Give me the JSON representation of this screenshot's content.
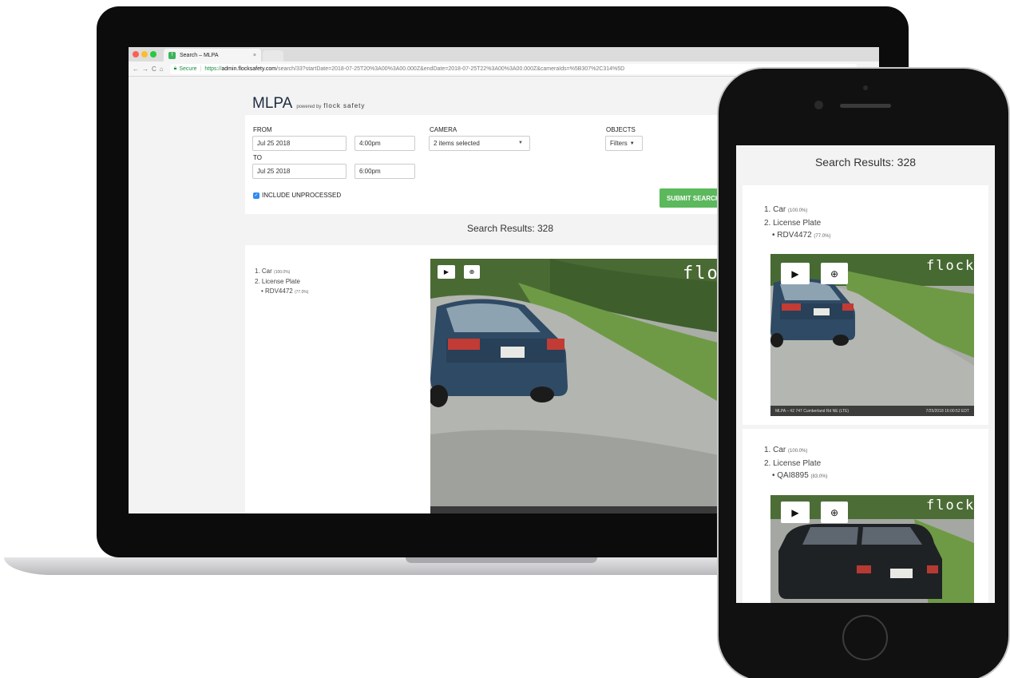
{
  "browser": {
    "tab_title": "Search – MLPA",
    "tab_close": "×",
    "secure_label": "Secure",
    "url_protocol": "https://",
    "url_host": "admin.flocksafety.com",
    "url_path": "/search/33?startDate=2018-07-25T20%3A00%3A00.000Z&endDate=2018-07-25T22%3A00%3A00.000Z&cameraIds=%5B307%2C314%5D"
  },
  "header": {
    "title": "MLPA",
    "powered_by": "powered by",
    "brand": "flock safety"
  },
  "form": {
    "from_label": "FROM",
    "from_date": "Jul 25 2018",
    "from_time": "4:00pm",
    "to_label": "TO",
    "to_date": "Jul 25 2018",
    "to_time": "6:00pm",
    "camera_label": "CAMERA",
    "camera_value": "2 items selected",
    "objects_label": "OBJECTS",
    "objects_value": "Filters",
    "include_label": "INCLUDE UNPROCESSED",
    "include_checked": true,
    "submit_label": "SUBMIT SEARCH"
  },
  "results_header": "Search Results: 328",
  "results": [
    {
      "item1": "1. Car",
      "item1_conf": "(100.0%)",
      "item2": "2. License Plate",
      "plate": "RDV4472",
      "plate_conf": "(77.0%)",
      "watermark": "flock",
      "caption_left": "MLPA – #2 747 Cumberland Rd NE (LTE)",
      "caption_right": "7/25/2018 16:00:52 EDT"
    },
    {
      "item1": "1. Car",
      "item1_conf": "(100.0%)",
      "item2": "2. License Plate",
      "plate": "QAI8895",
      "plate_conf": "(83.0%)",
      "watermark": "flock"
    }
  ],
  "colors": {
    "accent_green": "#5cb85c",
    "checkbox_blue": "#2d8cf0",
    "brand_navy": "#1f2c40"
  },
  "icons": [
    "play-icon",
    "zoom-in-icon",
    "lock-icon",
    "back-icon",
    "forward-icon",
    "reload-icon",
    "home-icon",
    "caret-down-icon"
  ]
}
